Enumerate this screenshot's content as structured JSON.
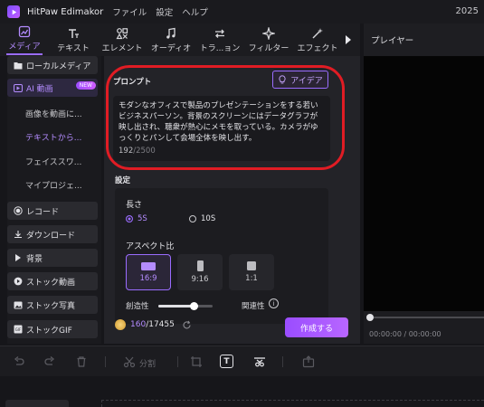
{
  "titlebar": {
    "app_name": "HitPaw Edimakor",
    "menus": [
      "ファイル",
      "設定",
      "ヘルプ"
    ],
    "year": "2025"
  },
  "toolbar": {
    "tabs": [
      {
        "label": "メディア",
        "icon": "media-icon",
        "active": true
      },
      {
        "label": "テキスト",
        "icon": "text-icon",
        "active": false
      },
      {
        "label": "エレメント",
        "icon": "element-icon",
        "active": false
      },
      {
        "label": "オーディオ",
        "icon": "audio-icon",
        "active": false
      },
      {
        "label": "トラ...ョン",
        "icon": "transition-icon",
        "active": false
      },
      {
        "label": "フィルター",
        "icon": "filter-icon",
        "active": false
      },
      {
        "label": "エフェクト",
        "icon": "effect-icon",
        "active": false
      }
    ],
    "more_icon": "chevron-right-icon"
  },
  "player": {
    "header": "プレイヤー",
    "timecode": "00:00:00 / 00:00:00"
  },
  "sidebar": {
    "items": [
      {
        "label": "ローカルメディア",
        "icon": "folder-icon"
      },
      {
        "label": "AI 動画",
        "icon": "ai-video-icon",
        "badge": "NEW"
      },
      {
        "label": "画像を動画に..."
      },
      {
        "label": "テキストから..."
      },
      {
        "label": "フェイススワ..."
      },
      {
        "label": "マイプロジェ..."
      },
      {
        "label": "レコード",
        "icon": "record-icon"
      },
      {
        "label": "ダウンロード",
        "icon": "download-icon"
      },
      {
        "label": "背景",
        "icon": "triangle-right-icon"
      },
      {
        "label": "ストック動画",
        "icon": "play-icon"
      },
      {
        "label": "ストック写真",
        "icon": "image-icon"
      },
      {
        "label": "ストックGIF",
        "icon": "gif-icon"
      }
    ]
  },
  "prompt": {
    "label": "プロンプト",
    "idea_button": "アイデア",
    "text": "モダンなオフィスで製品のプレゼンテーションをする若いビジネスパーソン。背景のスクリーンにはデータグラフが映し出され、聴衆が熱心にメモを取っている。カメラがゆっくりとパンして会場全体を映し出す。",
    "count": "192",
    "max": "/2500"
  },
  "settings": {
    "label": "設定",
    "length_label": "長さ",
    "length_options": [
      "5S",
      "10S"
    ],
    "length_selected": "5S",
    "aspect_label": "アスペクト比",
    "aspect_options": [
      "16:9",
      "9:16",
      "1:1"
    ],
    "aspect_selected": "16:9",
    "creativity_label": "創造性",
    "creativity_level": 0.65,
    "relevance_label": "関連性"
  },
  "credits": {
    "used": "160",
    "total": "/17455"
  },
  "create_button": "作成する",
  "timeline_toolbar": {
    "split_label": "分割"
  },
  "colors": {
    "accent": "#9a6cff",
    "highlight_ring": "#e01c24",
    "background": "#16161a"
  }
}
